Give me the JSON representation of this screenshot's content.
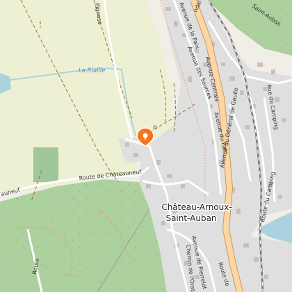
{
  "map": {
    "place_label_lines": [
      "Château-Arnoux-",
      "Saint-Auban"
    ],
    "roads": {
      "route_chateauneuf": "Route de Châteauneuf",
      "route_chateauneuf_west": "auneuf",
      "avenue_general_gaulle": "Avenue du Général de Gaulle",
      "avenue_general_gaulle_end": "Route de",
      "avenue_parc": "Avenue du Parc",
      "avenue_sources": "Avenue des Sources",
      "avenue_centrale": "Avenue Centrale",
      "avenue_provence": "Avenue de la Paix",
      "rue_camping": "Rue du Camping",
      "route_camping": "Route du Camping",
      "chemin_oratoire": "Chemin de l'Oratoire",
      "avenue_pierre": "Avenue de Pierrelat",
      "route_fin": "Route",
      "route_national": "ndal",
      "saint_auban_north": "Saint-Auban",
      "chemin_top": "Pignose"
    },
    "water": {
      "la_riaille": "La Riaille"
    },
    "marker": {
      "icon": "map-pin-icon",
      "color": "#f0771f"
    },
    "colors": {
      "background": "#f1eee8",
      "farmland": "#eef0d4",
      "forest": "#add19e",
      "water": "#aad3df",
      "residential": "#e0dfdf",
      "primary_road": "#fcd6a4",
      "railway": "#777777"
    }
  }
}
